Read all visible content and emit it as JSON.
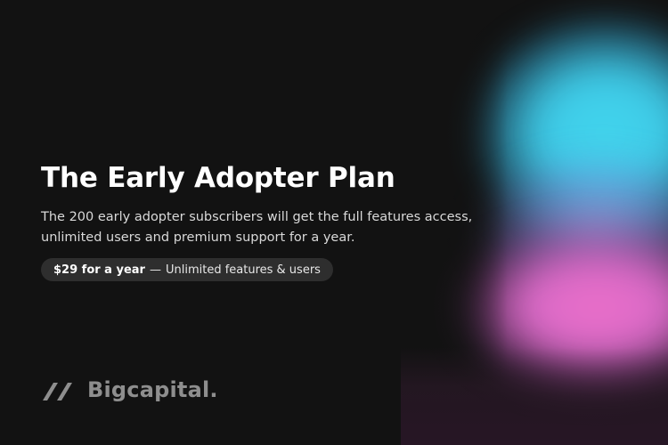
{
  "hero": {
    "title": "The Early Adopter Plan",
    "description": "The 200 early adopter subscribers will get the full features access, unlimited users and premium support for a year.",
    "badge": {
      "price": "$29 for a year",
      "separator": "—",
      "detail": "Unlimited features & users"
    }
  },
  "brand": {
    "name": "Bigcapital.",
    "icon": "double-slash-logo-icon"
  },
  "colors": {
    "background": "#121212",
    "glow_cyan": "#42d6ee",
    "glow_pink": "#ec6fc9",
    "badge_bg": "#2e2e2e",
    "logo_gray": "#8e8e8e"
  }
}
